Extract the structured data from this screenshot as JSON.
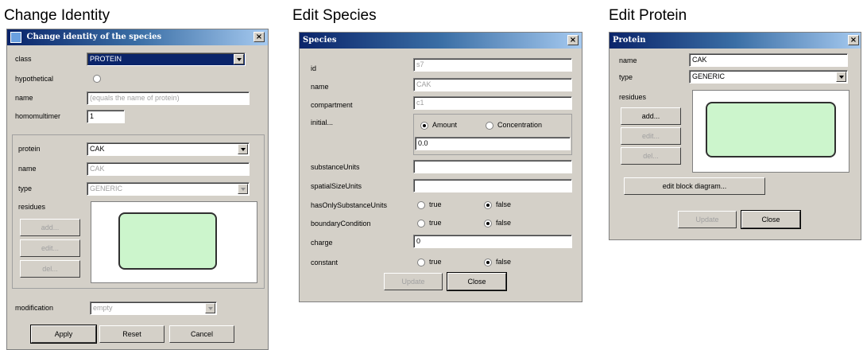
{
  "captions": {
    "change_identity": "Change Identity",
    "edit_species": "Edit Species",
    "edit_protein": "Edit Protein"
  },
  "change_identity": {
    "title": "Change identity of the species",
    "class_label": "class",
    "class_value": "PROTEIN",
    "hypothetical_label": "hypothetical",
    "name_label": "name",
    "name_placeholder": "(equals the name of protein)",
    "homomultimer_label": "homomultimer",
    "homomultimer_value": "1",
    "protein_label": "protein",
    "protein_value": "CAK",
    "protein_name_label": "name",
    "protein_name_value": "CAK",
    "type_label": "type",
    "type_value": "GENERIC",
    "residues_label": "residues",
    "add_label": "add...",
    "edit_label": "edit...",
    "del_label": "del...",
    "modification_label": "modification",
    "modification_value": "empty",
    "apply_label": "Apply",
    "reset_label": "Reset",
    "cancel_label": "Cancel"
  },
  "edit_species": {
    "title": "Species",
    "id_label": "id",
    "id_value": "s7",
    "name_label": "name",
    "name_value": "CAK",
    "compartment_label": "compartment",
    "compartment_value": "c1",
    "initial_label": "initial...",
    "amount_label": "Amount",
    "concentration_label": "Concentration",
    "initial_value": "0.0",
    "substance_units_label": "substanceUnits",
    "spatial_size_units_label": "spatialSizeUnits",
    "has_only_label": "hasOnlySubstanceUnits",
    "boundary_label": "boundaryCondition",
    "charge_label": "charge",
    "charge_value": "0",
    "constant_label": "constant",
    "true_label": "true",
    "false_label": "false",
    "update_label": "Update",
    "close_label": "Close"
  },
  "edit_protein": {
    "title": "Protein",
    "name_label": "name",
    "name_value": "CAK",
    "type_label": "type",
    "type_value": "GENERIC",
    "residues_label": "residues",
    "add_label": "add...",
    "edit_label": "edit...",
    "del_label": "del...",
    "block_label": "edit block diagram...",
    "update_label": "Update",
    "close_label": "Close"
  }
}
